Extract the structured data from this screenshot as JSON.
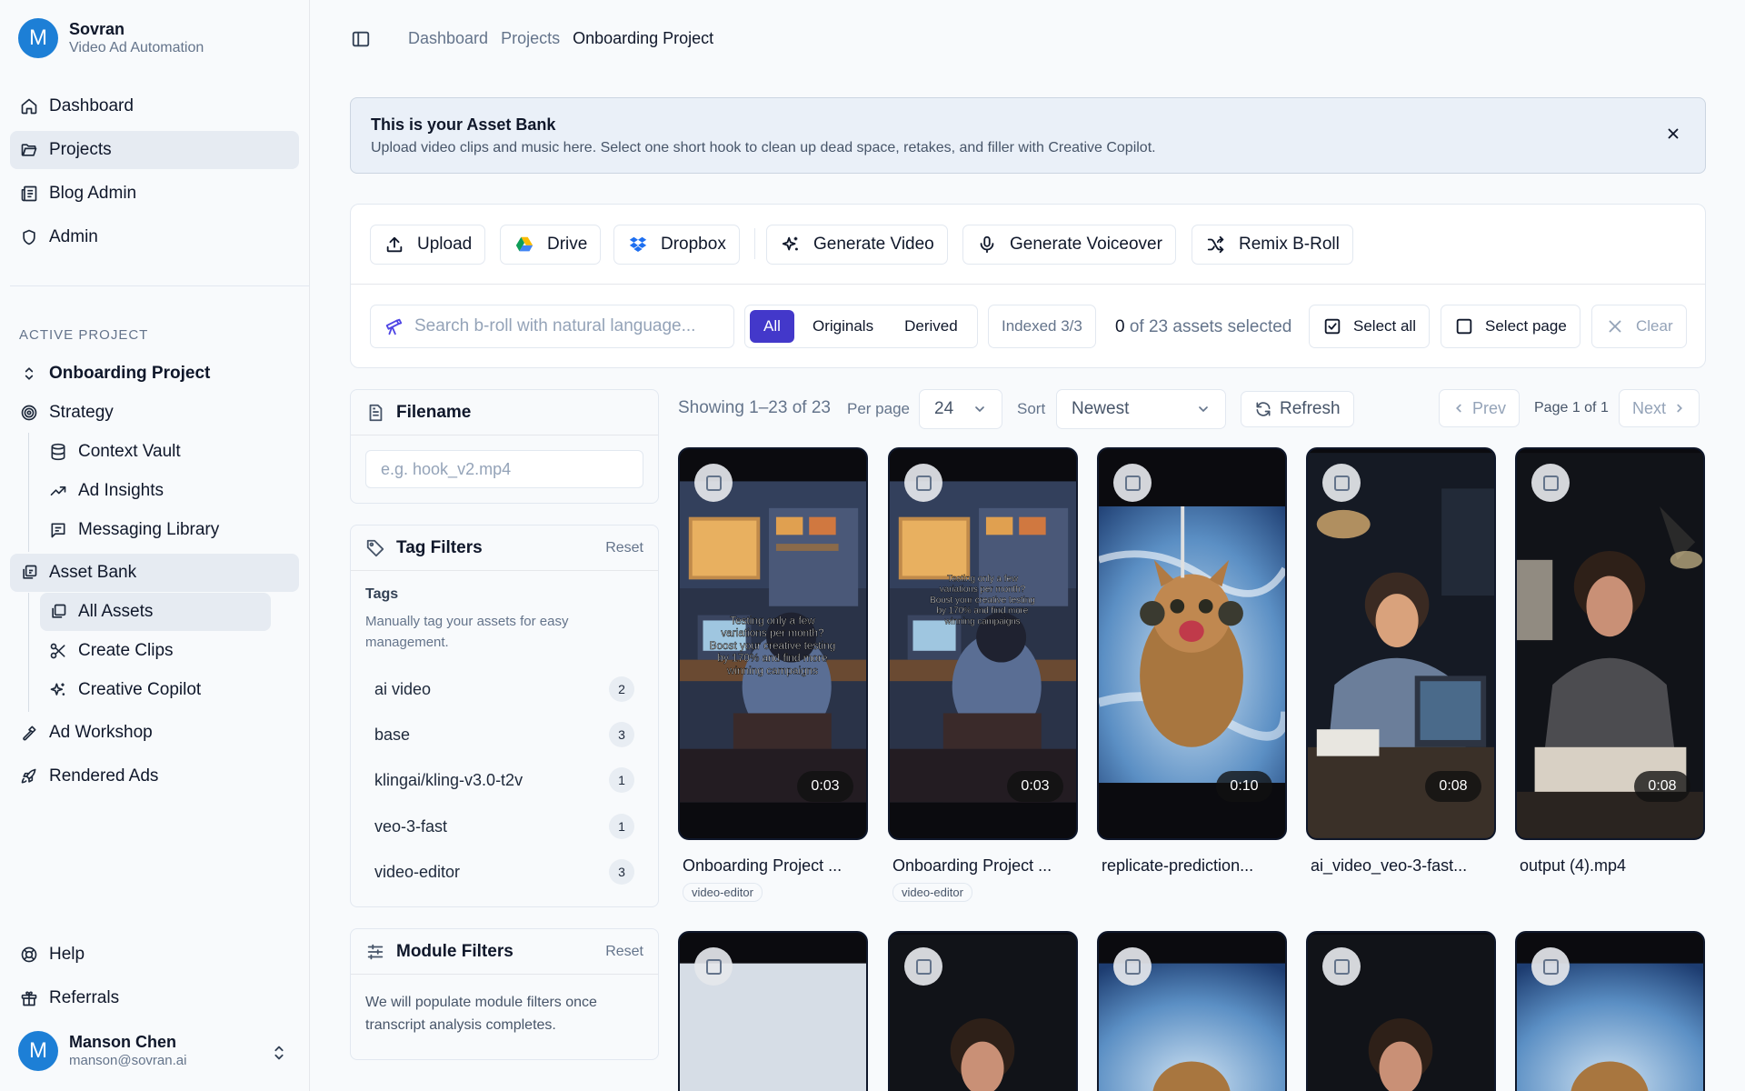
{
  "brand": {
    "initial": "M",
    "name": "Sovran",
    "tagline": "Video Ad Automation"
  },
  "nav": {
    "main": [
      {
        "label": "Dashboard",
        "icon": "home-icon"
      },
      {
        "label": "Projects",
        "icon": "folder-icon",
        "active": true
      },
      {
        "label": "Blog Admin",
        "icon": "newspaper-icon"
      },
      {
        "label": "Admin",
        "icon": "shield-icon"
      }
    ],
    "section_label": "ACTIVE PROJECT",
    "project": "Onboarding Project",
    "strategy": "Strategy",
    "strategy_children": [
      "Context Vault",
      "Ad Insights",
      "Messaging Library"
    ],
    "asset_bank": "Asset Bank",
    "asset_children": [
      "All Assets",
      "Create Clips",
      "Creative Copilot"
    ],
    "ad_workshop": "Ad Workshop",
    "rendered_ads": "Rendered Ads",
    "help": "Help",
    "referrals": "Referrals"
  },
  "user": {
    "initial": "M",
    "name": "Manson Chen",
    "email": "manson@sovran.ai"
  },
  "breadcrumb": [
    "Dashboard",
    "Projects",
    "Onboarding Project"
  ],
  "banner": {
    "title": "This is your Asset Bank",
    "text": "Upload video clips and music here. Select one short hook to clean up dead space, retakes, and filler with Creative Copilot."
  },
  "toolbar": {
    "upload": "Upload",
    "drive": "Drive",
    "dropbox": "Dropbox",
    "generate_video": "Generate Video",
    "generate_voiceover": "Generate Voiceover",
    "remix_broll": "Remix B-Roll"
  },
  "search": {
    "placeholder": "Search b-roll with natural language..."
  },
  "segments": [
    "All",
    "Originals",
    "Derived"
  ],
  "indexed": "Indexed 3/3",
  "selection": {
    "count": "0",
    "suffix": "of 23 assets selected"
  },
  "select_all": "Select all",
  "select_page": "Select page",
  "clear": "Clear",
  "filters": {
    "filename": {
      "title": "Filename",
      "placeholder": "e.g. hook_v2.mp4"
    },
    "tags": {
      "title": "Tag Filters",
      "reset": "Reset",
      "subtitle": "Tags",
      "description": "Manually tag your assets for easy management.",
      "items": [
        {
          "label": "ai video",
          "count": "2"
        },
        {
          "label": "base",
          "count": "3"
        },
        {
          "label": "klingai/kling-v3.0-t2v",
          "count": "1"
        },
        {
          "label": "veo-3-fast",
          "count": "1"
        },
        {
          "label": "video-editor",
          "count": "3"
        }
      ]
    },
    "modules": {
      "title": "Module Filters",
      "reset": "Reset",
      "text": "We will populate module filters once transcript analysis completes."
    }
  },
  "grid_controls": {
    "showing": "Showing 1–23 of 23",
    "per_page_label": "Per page",
    "per_page": "24",
    "sort_label": "Sort",
    "sort": "Newest",
    "refresh": "Refresh",
    "prev": "Prev",
    "page": "Page 1 of 1",
    "next": "Next"
  },
  "assets": [
    {
      "title": "Onboarding Project ...",
      "duration": "0:03",
      "tag": "video-editor"
    },
    {
      "title": "Onboarding Project ...",
      "duration": "0:03",
      "tag": "video-editor"
    },
    {
      "title": "replicate-prediction...",
      "duration": "0:10",
      "tag": ""
    },
    {
      "title": "ai_video_veo-3-fast...",
      "duration": "0:08",
      "tag": ""
    },
    {
      "title": "output (4).mp4",
      "duration": "0:08",
      "tag": ""
    }
  ],
  "colors": {
    "accent": "#4338ca",
    "avatar": "#1d7fd6",
    "nav_active": "#e6ebf2"
  }
}
